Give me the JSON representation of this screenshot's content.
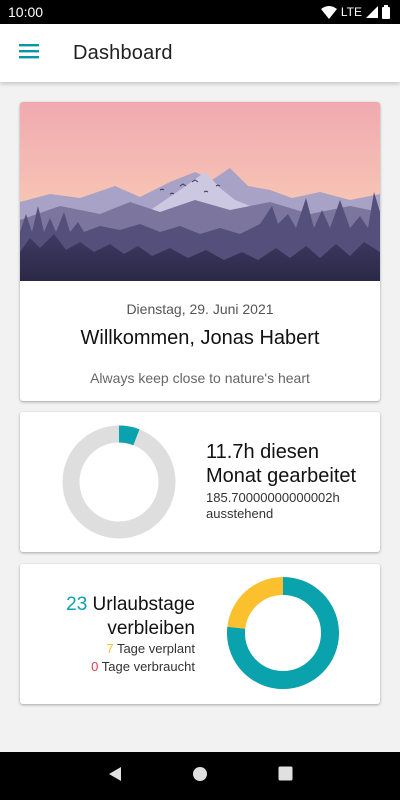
{
  "status_bar": {
    "time": "10:00",
    "network": "LTE",
    "icons": [
      "wifi-icon",
      "cellular-signal-icon",
      "battery-icon"
    ]
  },
  "app_bar": {
    "menu_icon": "menu-icon",
    "title": "Dashboard"
  },
  "welcome_card": {
    "image": "mountain-landscape-illustration",
    "date": "Dienstag, 29. Juni 2021",
    "greeting": "Willkommen, Jonas Habert",
    "quote": "Always keep close to nature's heart"
  },
  "work_card": {
    "hours_text": "11.7h diesen Monat gearbeitet",
    "pending_text": "185.70000000000002h ausstehend",
    "chart": {
      "worked_fraction": 0.059,
      "worked_color": "#0aa2ac",
      "remaining_color": "#dedede"
    }
  },
  "vacation_card": {
    "remaining_number": "23",
    "remaining_label": "Urlaubstage verbleiben",
    "planned_number": "7",
    "planned_label": "Tage verplant",
    "used_number": "0",
    "used_label": "Tage verbraucht",
    "chart": {
      "segments": [
        {
          "label": "verbleibend",
          "value": 23,
          "color": "#0aa2ac"
        },
        {
          "label": "verplant",
          "value": 7,
          "color": "#fbc02d"
        },
        {
          "label": "verbraucht",
          "value": 0,
          "color": "#e53950"
        }
      ]
    }
  },
  "colors": {
    "accent": "#0aa2ac",
    "planned": "#fbc02d",
    "used": "#e53950"
  },
  "nav_bar": {
    "icons": [
      "back-icon",
      "home-icon",
      "recents-icon"
    ]
  }
}
